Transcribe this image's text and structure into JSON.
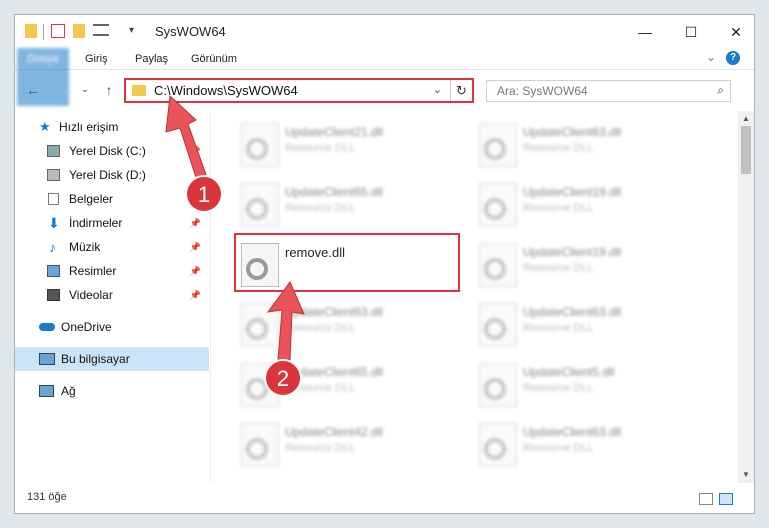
{
  "titlebar": {
    "title": "SysWOW64",
    "minimize": "—",
    "maximize": "☐",
    "close": "✕"
  },
  "ribbon": {
    "tabs": [
      "Dosya",
      "Giriş",
      "Paylaş",
      "Görünüm"
    ],
    "expand": "⌄",
    "help": "?"
  },
  "address": {
    "path": "C:\\Windows\\SysWOW64",
    "dropdown": "⌄",
    "refresh": "↻"
  },
  "nav": {
    "back": "←",
    "forward": "→",
    "recent": "⌄",
    "up": "↑"
  },
  "search": {
    "placeholder": "Ara: SysWOW64",
    "icon": "⌕"
  },
  "sidebar": {
    "items": [
      {
        "label": "Hızlı erişim",
        "icon": "star-icon"
      },
      {
        "label": "Yerel Disk (C:)",
        "icon": "drive-icon"
      },
      {
        "label": "Yerel Disk (D:)",
        "icon": "drive-icon"
      },
      {
        "label": "Belgeler",
        "icon": "documents-icon"
      },
      {
        "label": "İndirmeler",
        "icon": "download-icon"
      },
      {
        "label": "Müzik",
        "icon": "music-icon"
      },
      {
        "label": "Resimler",
        "icon": "pictures-icon"
      },
      {
        "label": "Videolar",
        "icon": "videos-icon"
      },
      {
        "label": "OneDrive",
        "icon": "cloud-icon"
      },
      {
        "label": "Bu bilgisayar",
        "icon": "computer-icon"
      },
      {
        "label": "Ağ",
        "icon": "network-icon"
      }
    ]
  },
  "files": [
    {
      "name": "UpdateClient21.dll",
      "desc": "Resource DLL"
    },
    {
      "name": "UpdateClient63.dll",
      "desc": "Resource DLL"
    },
    {
      "name": "UpdateClient65.dll",
      "desc": "Resource DLL"
    },
    {
      "name": "UpdateClient19.dll",
      "desc": "Resource DLL"
    },
    {
      "name": "remove.dll",
      "desc": ""
    },
    {
      "name": "UpdateClient19.dll",
      "desc": "Resource DLL"
    },
    {
      "name": "UpdateClient63.dll",
      "desc": "Resource DLL"
    },
    {
      "name": "UpdateClient63.dll",
      "desc": "Resource DLL"
    },
    {
      "name": "UpdateClient65.dll",
      "desc": "Resource DLL"
    },
    {
      "name": "UpdateClient5.dll",
      "desc": "Resource DLL"
    },
    {
      "name": "UpdateClient42.dll",
      "desc": "Resource DLL"
    },
    {
      "name": "UpdateClient63.dll",
      "desc": "Resource DLL"
    }
  ],
  "status": {
    "count": "131 öğe"
  },
  "callouts": {
    "one": "1",
    "two": "2"
  },
  "colors": {
    "accent": "#1979ca",
    "highlight": "#d9363b",
    "selection": "#cce4f7"
  }
}
